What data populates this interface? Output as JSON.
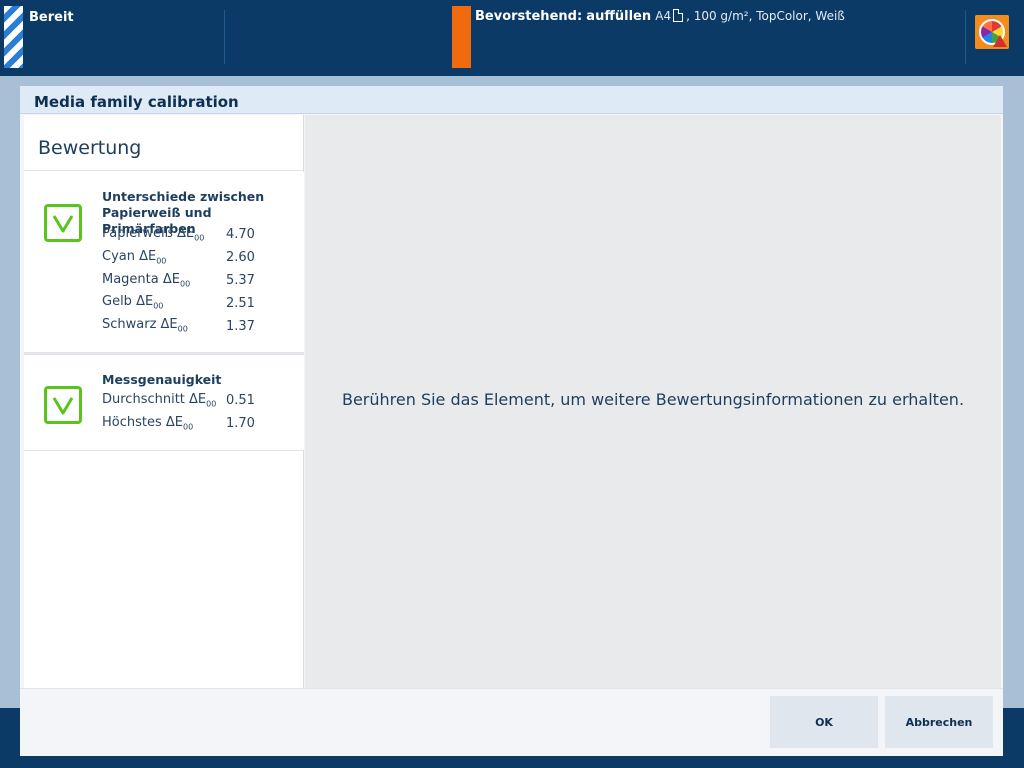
{
  "topbar": {
    "status": "Bereit",
    "upcoming_label": "Bevorstehend:",
    "upcoming_action": "auffüllen",
    "paper_size": "A4",
    "paper_details": ", 100 g/m², TopColor, Weiß",
    "colors": {
      "background": "#0b3a66",
      "warning": "#f06a0e",
      "stripe": "#2a7fd4"
    }
  },
  "modal": {
    "title": "Media family calibration",
    "panel_heading": "Bewertung",
    "cards": [
      {
        "title": "Unterschiede zwischen Papierweiß und Primärfarben",
        "metrics": [
          {
            "label": "Papierweiß ΔE",
            "sub": "00",
            "value": "4.70"
          },
          {
            "label": "Cyan ΔE",
            "sub": "00",
            "value": "2.60"
          },
          {
            "label": "Magenta ΔE",
            "sub": "00",
            "value": "5.37"
          },
          {
            "label": "Gelb ΔE",
            "sub": "00",
            "value": "2.51"
          },
          {
            "label": "Schwarz ΔE",
            "sub": "00",
            "value": "1.37"
          }
        ]
      },
      {
        "title": "Messgenauigkeit",
        "metrics": [
          {
            "label": "Durchschnitt ΔE",
            "sub": "00",
            "value": "0.51"
          },
          {
            "label": "Höchstes ΔE",
            "sub": "00",
            "value": "1.70"
          }
        ]
      }
    ],
    "info_text": "Berühren Sie das Element, um weitere Bewertungsinformationen zu erhalten.",
    "buttons": {
      "ok": "OK",
      "cancel": "Abbrechen"
    },
    "accent_green": "#58c41c"
  }
}
